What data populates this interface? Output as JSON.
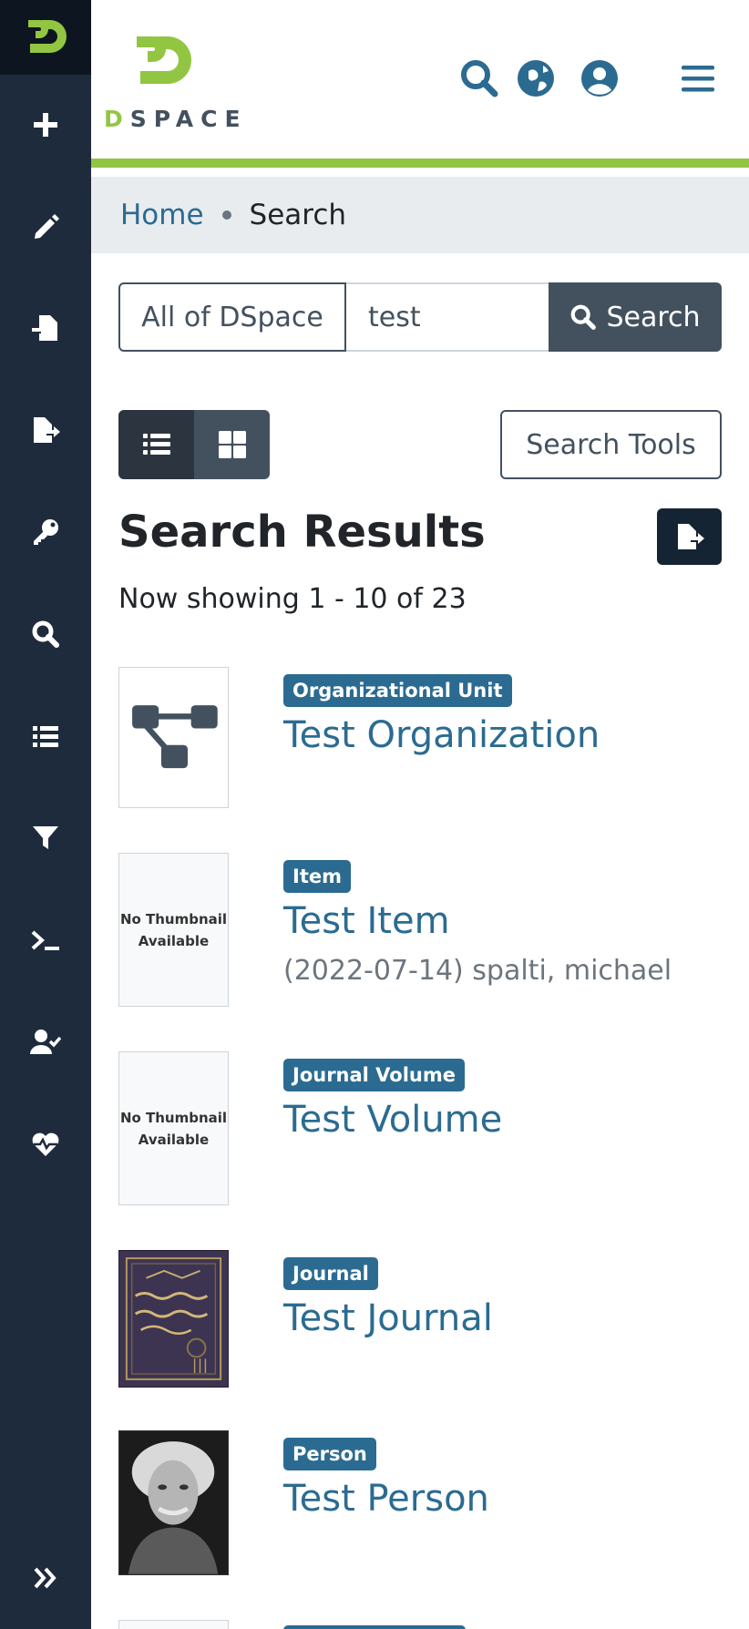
{
  "header": {
    "brand_name": "DSPACE",
    "brand_first_letter": "D",
    "brand_rest": "SPACE",
    "icons": [
      "search-icon",
      "globe-icon",
      "user-circle-icon",
      "hamburger-menu-icon"
    ]
  },
  "sidebar": {
    "items": [
      {
        "name": "add",
        "icon": "plus-icon"
      },
      {
        "name": "edit",
        "icon": "pencil-icon"
      },
      {
        "name": "import",
        "icon": "file-import-icon"
      },
      {
        "name": "export",
        "icon": "file-export-icon"
      },
      {
        "name": "access-control",
        "icon": "key-icon"
      },
      {
        "name": "admin-search",
        "icon": "search-icon"
      },
      {
        "name": "registries",
        "icon": "list-icon"
      },
      {
        "name": "curation-task",
        "icon": "filter-icon"
      },
      {
        "name": "processes",
        "icon": "terminal-icon"
      },
      {
        "name": "workflow",
        "icon": "user-check-icon"
      },
      {
        "name": "health",
        "icon": "heartbeat-icon"
      }
    ],
    "expand_icon": "double-chevron-right-icon"
  },
  "breadcrumb": {
    "home": "Home",
    "current": "Search"
  },
  "search": {
    "scope_label": "All of DSpace",
    "query": "test",
    "button_label": "Search"
  },
  "view": {
    "list_icon": "list-view-icon",
    "grid_icon": "grid-view-icon",
    "tools_label": "Search Tools"
  },
  "results": {
    "title": "Search Results",
    "showing": "Now showing 1 - 10 of 23",
    "items": [
      {
        "type": "Organizational Unit",
        "title": "Test Organization",
        "meta": "",
        "thumb": "org-unit-icon"
      },
      {
        "type": "Item",
        "title": "Test Item",
        "meta": "(2022-07-14) spalti, michael",
        "thumb": "No Thumbnail Available"
      },
      {
        "type": "Journal Volume",
        "title": "Test Volume",
        "meta": "",
        "thumb": "No Thumbnail Available"
      },
      {
        "type": "Journal",
        "title": "Test Journal",
        "meta": "",
        "thumb": "journal-cover-image"
      },
      {
        "type": "Person",
        "title": "Test Person",
        "meta": "",
        "thumb": "person-portrait-image"
      }
    ]
  },
  "colors": {
    "sidebar_bg": "#1e2b3c",
    "accent_green": "#92c642",
    "link_blue": "#2b6b91",
    "button_gray": "#43515f"
  }
}
